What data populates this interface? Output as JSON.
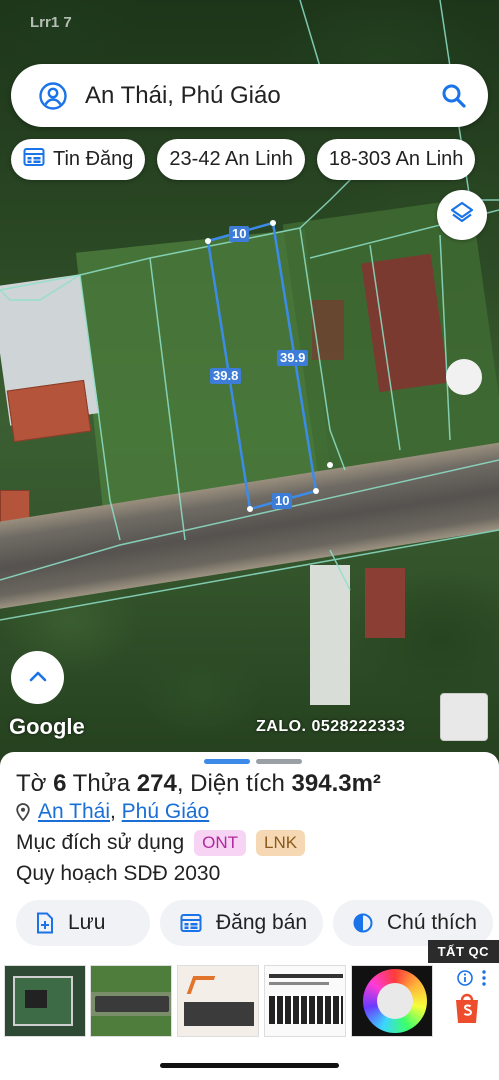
{
  "status": {
    "carrier": "Lrr1 7"
  },
  "search": {
    "query": "An Thái, Phú Giáo"
  },
  "chips": [
    {
      "label": "Tin Đăng",
      "icon": "calendar-list-icon"
    },
    {
      "label": "23-42 An Linh"
    },
    {
      "label": "18-303 An Linh"
    }
  ],
  "map": {
    "attribution": "Google",
    "watermark": "ZALO. 0528222333",
    "plot_dimensions": {
      "top": "10",
      "left": "39.8",
      "right": "39.9",
      "bottom": "10"
    }
  },
  "parcel": {
    "title_prefix": "Tờ ",
    "sheet_no": "6",
    "parcel_label": " Thửa ",
    "parcel_no": "274",
    "area_label": ", Diện tích ",
    "area_value": "394.3m²",
    "commune": "An Thái",
    "separator": ", ",
    "district": "Phú Giáo",
    "purpose_label": "Mục đích sử dụng",
    "purpose_codes": [
      {
        "code": "ONT",
        "bg": "#f7d4f3",
        "fg": "#b2279f"
      },
      {
        "code": "LNK",
        "bg": "#f6d9b4",
        "fg": "#8a5a1c"
      }
    ],
    "plan_label": "Quy hoạch SDĐ 2030"
  },
  "actions": [
    {
      "label": "Lưu",
      "icon": "add-file-icon"
    },
    {
      "label": "Đăng bán",
      "icon": "list-icon"
    },
    {
      "label": "Chú thích",
      "icon": "half-circle-icon"
    }
  ],
  "ads": {
    "tag": "TẤT QC"
  },
  "colors": {
    "accent": "#1a73e8",
    "handle_active": "#3d8be8",
    "handle_inactive": "#9aa0a6"
  }
}
